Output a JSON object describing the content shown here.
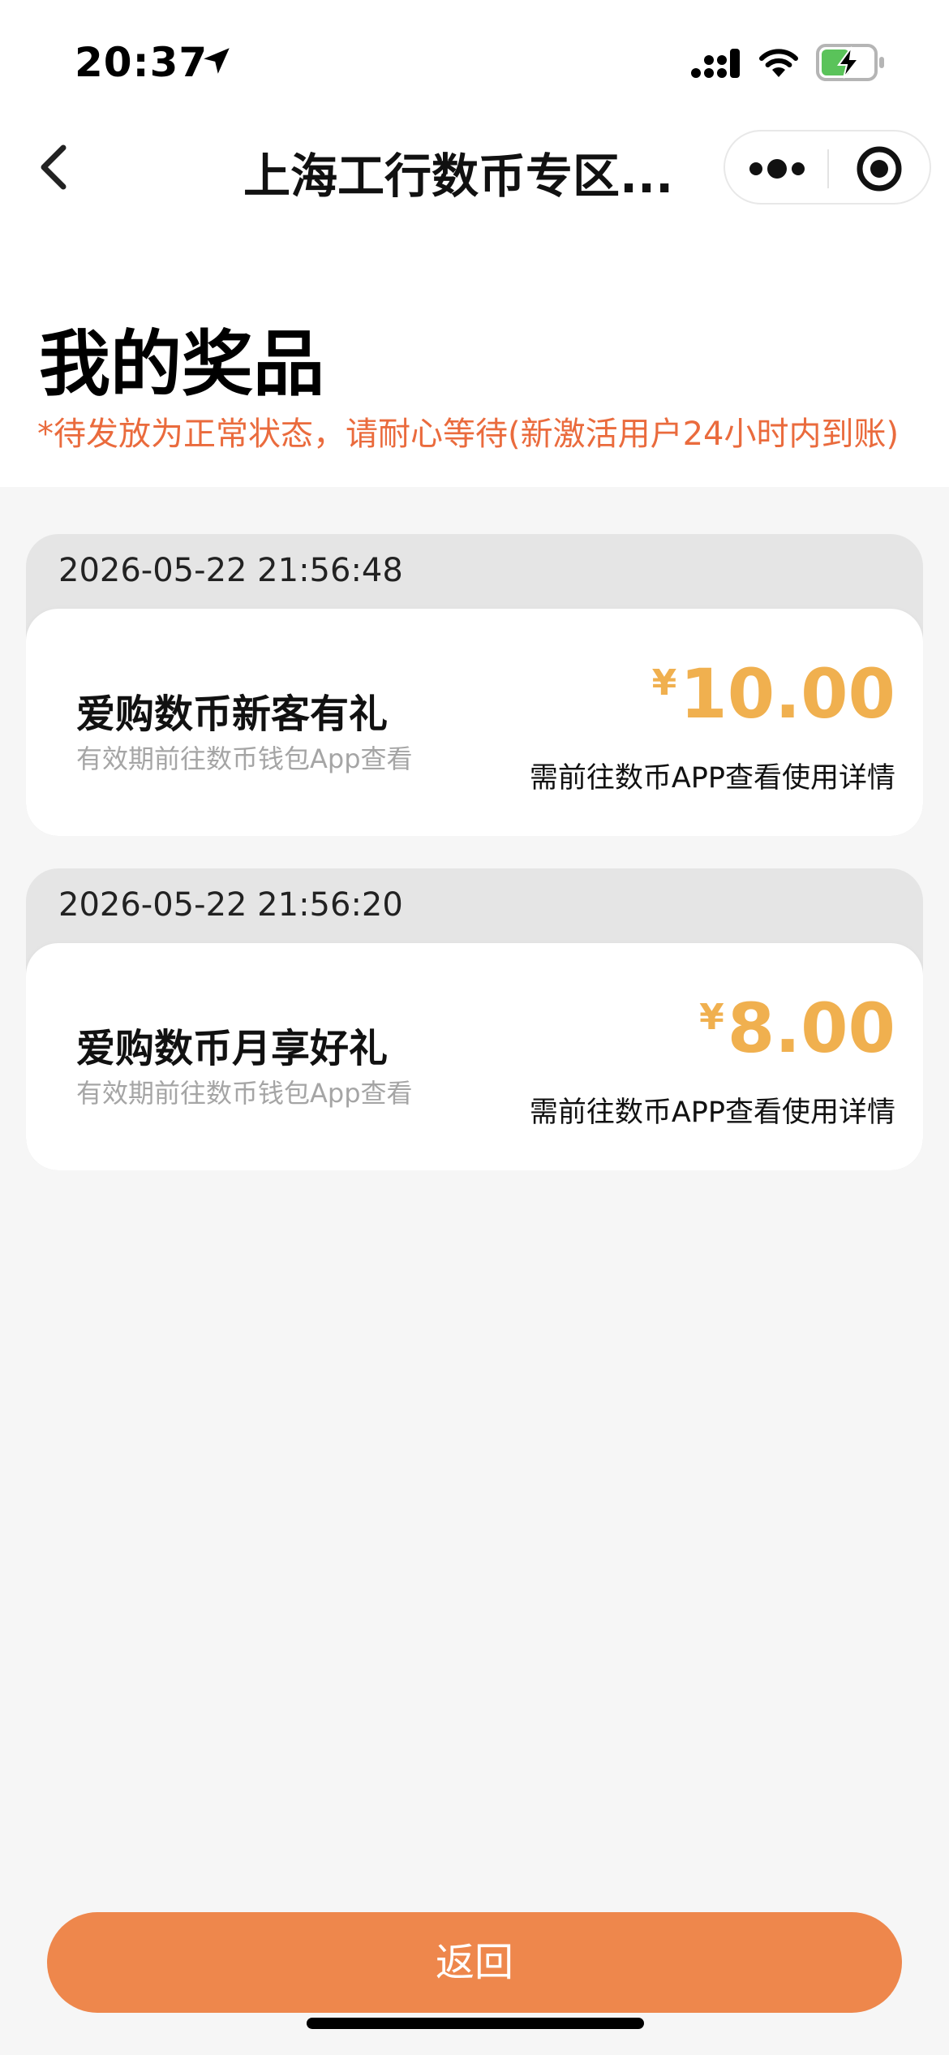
{
  "status_bar": {
    "time": "20:37",
    "location_icon": "location-arrow-icon",
    "signal_icon": "cellular-signal-icon",
    "wifi_icon": "wifi-icon",
    "battery_icon": "battery-charging-icon"
  },
  "nav": {
    "title": "上海工行数币专区...",
    "back_icon": "chevron-left-icon",
    "more_icon": "more-dots-icon",
    "close_icon": "record-target-icon"
  },
  "page": {
    "title": "我的奖品",
    "notice": "*待发放为正常状态，请耐心等待(新激活用户24小时内到账)"
  },
  "prizes": [
    {
      "date": "2026-05-22 21:56:48",
      "name": "爱购数币新客有礼",
      "validity": "有效期前往数币钱包App查看",
      "currency": "¥",
      "amount": "10.00",
      "hint": "需前往数币APP查看使用详情"
    },
    {
      "date": "2026-05-22 21:56:20",
      "name": "爱购数币月享好礼",
      "validity": "有效期前往数币钱包App查看",
      "currency": "¥",
      "amount": "8.00",
      "hint": "需前往数币APP查看使用详情"
    }
  ],
  "footer": {
    "return_label": "返回"
  },
  "colors": {
    "accent": "#ee874c",
    "notice": "#ea6b3d",
    "price": "#f0b04f",
    "card_header": "#e5e5e5",
    "background": "#f6f6f6"
  }
}
